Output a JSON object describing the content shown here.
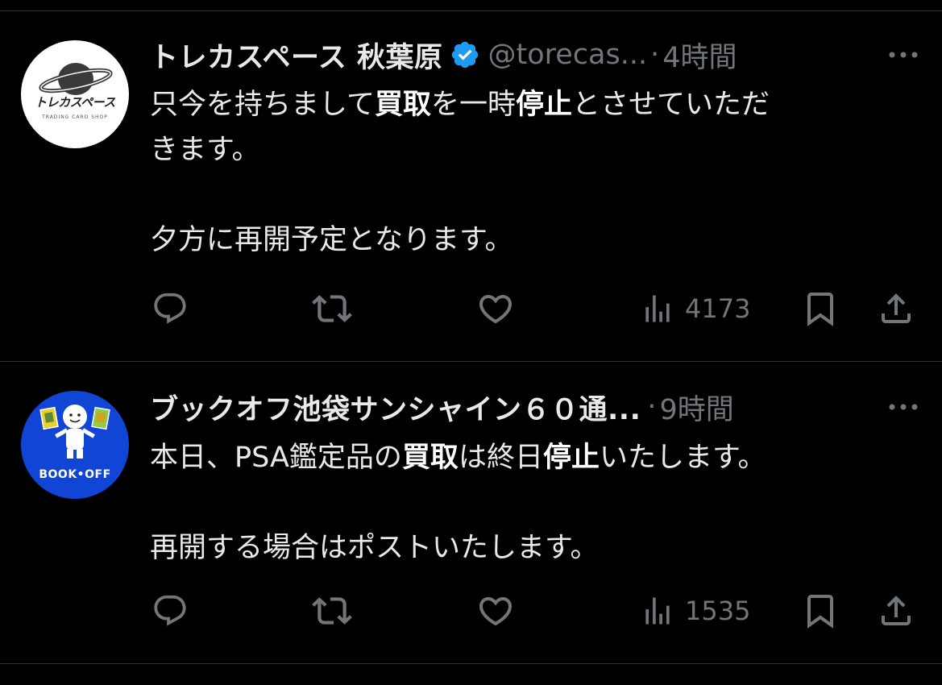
{
  "colors": {
    "background": "#000000",
    "text_primary": "#e7e9ea",
    "text_secondary": "#71767b",
    "verified_badge": "#1d9bf0",
    "divider": "#2f3336",
    "bookoff_blue": "#1045d6"
  },
  "tweets": [
    {
      "avatar": {
        "icon": "trecaspace-logo",
        "brand_text": "トレカスペース",
        "sub_text": "TRADING CARD SHOP"
      },
      "name": "トレカスペース 秋葉原",
      "verified": true,
      "handle": "@torecas...",
      "dot": "·",
      "time": "4時間",
      "body": {
        "line1_pre": "只今を持ちまして",
        "line1_b1": "買取",
        "line1_mid": "を一時",
        "line1_b2": "停止",
        "line1_post": "とさせていただ",
        "line2": "きます。",
        "line3": "夕方に再開予定となります。"
      },
      "views": "4173"
    },
    {
      "avatar": {
        "icon": "bookoff-mascot",
        "brand_text": "BOOK•OFF"
      },
      "name": "ブックオフ池袋サンシャイン６０通...",
      "verified": false,
      "dot": "·",
      "time": "9時間",
      "body": {
        "line1_pre": "本日、PSA鑑定品の",
        "line1_b1": "買取",
        "line1_mid": "は終日",
        "line1_b2": "停止",
        "line1_post": "いたします。",
        "line3": "再開する場合はポストいたします。"
      },
      "views": "1535"
    }
  ]
}
